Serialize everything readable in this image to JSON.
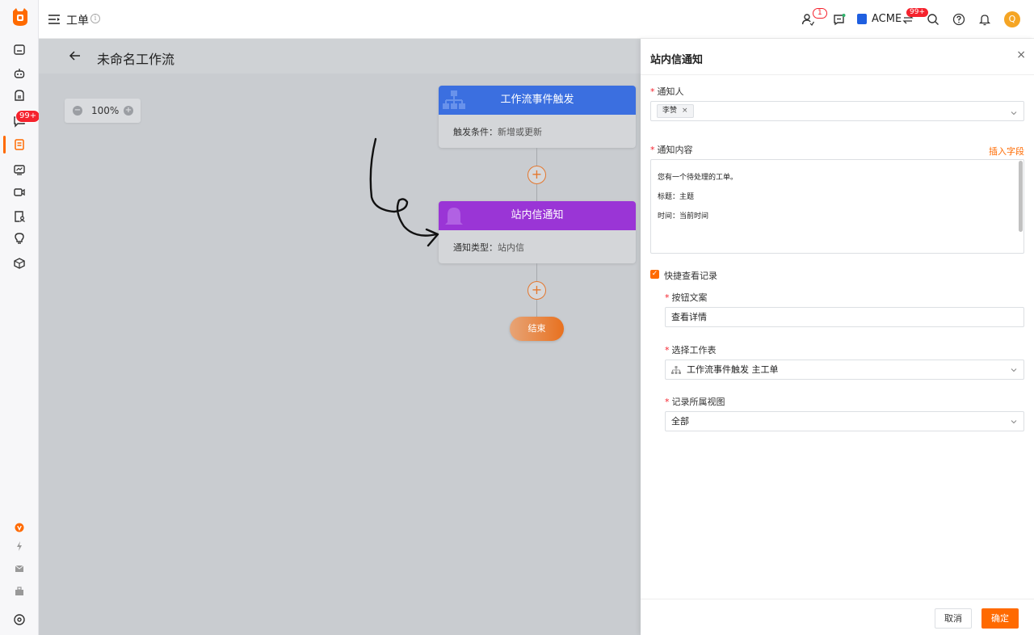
{
  "header": {
    "title": "工单",
    "info_icon": "i",
    "notify_badge": "1",
    "brand": "ACME",
    "switch_badge": "99+",
    "avatar": "Q"
  },
  "sidebar": {
    "message_badge": "99+"
  },
  "workflow": {
    "title": "未命名工作流",
    "zoom": "100%",
    "trigger_node": {
      "title": "工作流事件触发",
      "label": "触发条件：",
      "value": "新增或更新",
      "color": "#3b6fe0"
    },
    "notify_node": {
      "title": "站内信通知",
      "label": "通知类型：",
      "value": "站内信",
      "color": "#9a35d6"
    },
    "end_label": "结束",
    "plus": "+"
  },
  "panel": {
    "title": "站内信通知",
    "close": "×",
    "recipient_label": "通知人",
    "recipient_tag": "李赞",
    "content_label": "通知内容",
    "insert_field": "插入字段",
    "content_lines": [
      "您有一个待处理的工单。",
      "标题：主题",
      "时间：当前时间"
    ],
    "quick_view_label": "快捷查看记录",
    "button_text_label": "按钮文案",
    "button_text_value": "查看详情",
    "worksheet_label": "选择工作表",
    "worksheet_value": "工作流事件触发  主工单",
    "view_label": "记录所属视图",
    "view_value": "全部",
    "cancel": "取消",
    "confirm": "确定",
    "accent": "#ff6a00"
  }
}
